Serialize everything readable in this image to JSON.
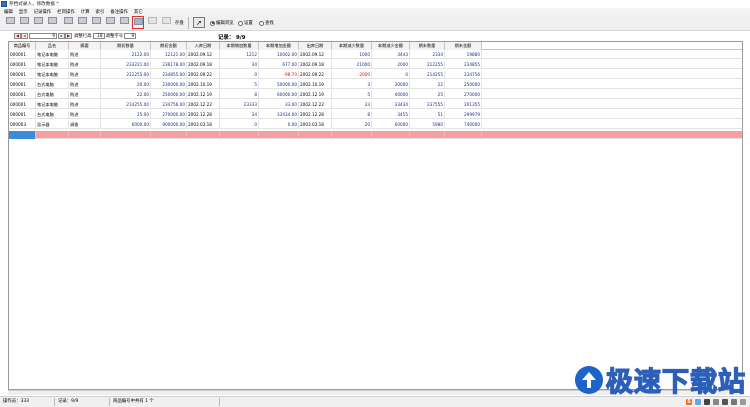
{
  "window": {
    "title": "存档式录入，修改数据 *"
  },
  "menu": [
    "编辑",
    "显示",
    "记录操作",
    "栏目操作",
    "计算",
    "索引",
    "备注操作",
    "其它"
  ],
  "toolbar": {
    "buttons": [
      {
        "label": "",
        "icon": "first-record-icon"
      },
      {
        "label": "",
        "icon": "prev-record-icon"
      },
      {
        "label": "",
        "icon": "next-record-icon"
      },
      {
        "label": "",
        "icon": "last-record-icon"
      },
      {
        "label": "",
        "icon": "insert-record-icon"
      },
      {
        "label": "",
        "icon": "append-record-icon"
      },
      {
        "label": "",
        "icon": "delete-record-icon"
      },
      {
        "label": "",
        "icon": "copy-record-icon"
      },
      {
        "label": "",
        "icon": "paste-record-icon"
      },
      {
        "label": "",
        "icon": "sort-icon"
      },
      {
        "label": "",
        "icon": "filter-icon"
      },
      {
        "label": "",
        "icon": "calc-icon"
      }
    ],
    "save_label": "存盘",
    "radio_options": [
      {
        "label": "编辑浏览",
        "checked": true
      },
      {
        "label": "设置",
        "checked": false
      },
      {
        "label": "查找",
        "checked": false
      }
    ]
  },
  "nav": {
    "current": "9",
    "row_height_label": "调整行高",
    "row_height": "18",
    "font_label": "调整字号",
    "font_size": "9",
    "record_info": "记录： 9/9"
  },
  "table": {
    "columns": [
      "商品编号",
      "品名",
      "摘要",
      "期初数量",
      "期初金额",
      "入库日期",
      "本期增加数量",
      "本期增加金额",
      "出库日期",
      "本期减少数量",
      "本期减少金额",
      "期末数量",
      "期末金额"
    ],
    "rows": [
      [
        "000001",
        "笔记本电脑",
        "购进",
        "2122.00",
        "12121.00",
        "2002.09.12",
        "1212",
        "10002.00",
        "2002.09.12",
        "1000",
        "3443",
        "2334",
        "19880"
      ],
      [
        "000001",
        "笔记本电脑",
        "购进",
        "233221.00",
        "236178.00",
        "2002.09.18",
        "34",
        "677.00",
        "2002.09.18",
        "21000",
        "2000",
        "212255",
        "234855"
      ],
      [
        "000001",
        "笔记本电脑",
        "购进",
        "212255.00",
        "234855.00",
        "2002.09.22",
        "0",
        "-98.70",
        "2002.09.22",
        "-2000",
        "0",
        "214255",
        "234756"
      ],
      [
        "000001",
        "台式电脑",
        "购进",
        "20.00",
        "230000.00",
        "2002.10.19",
        "5",
        "50000.00",
        "2002.10.19",
        "3",
        "30000",
        "22",
        "250000"
      ],
      [
        "000001",
        "台式电脑",
        "购进",
        "22.00",
        "250000.00",
        "2002.12.19",
        "8",
        "60000.00",
        "2002.12.19",
        "5",
        "40000",
        "25",
        "270000"
      ],
      [
        "000001",
        "笔记本电脑",
        "购进",
        "214255.00",
        "234756.00",
        "2002.12.22",
        "23333",
        "33.00",
        "2002.12.22",
        "33",
        "33434",
        "237555",
        "201355"
      ],
      [
        "000001",
        "台式电脑",
        "购进",
        "25.00",
        "270000.00",
        "2002.12.28",
        "34",
        "33434.00",
        "2002.12.28",
        "8",
        "3455",
        "51",
        "299979"
      ],
      [
        "000003",
        "显示器",
        "调拨",
        "6000.00",
        "900000.00",
        "2003.03.18",
        "0",
        "0.00",
        "2003.03.18",
        "20",
        "60000",
        "5980",
        "740000"
      ]
    ],
    "negative_cells": [
      [
        2,
        7
      ],
      [
        2,
        9
      ]
    ]
  },
  "status": {
    "operator": "操作员：333",
    "record": "记录：9/9",
    "summary": "商品编号中共有 1 个"
  },
  "watermark": {
    "text": "极速下载站"
  },
  "colors": {
    "new_row": "#f79e9e",
    "selected_cell": "#3c8dd8",
    "negative": "#d01010",
    "number": "#1b2a8a"
  }
}
